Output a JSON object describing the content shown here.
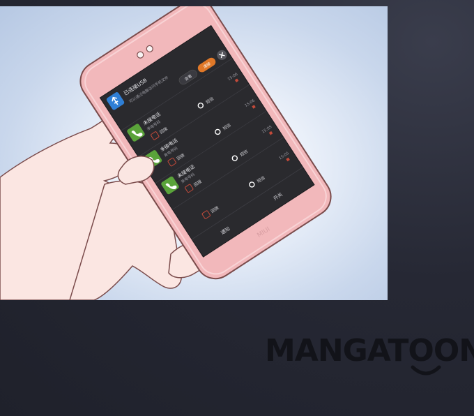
{
  "phone": {
    "status_title": "已连接USB",
    "status_subtitle": "可以通过电脑访问手机文件",
    "button_view": "查看",
    "button_close_all": "清除",
    "button_mark": "清除",
    "notifications": [
      {
        "title": "未接电话",
        "subtitle": "来电号码",
        "action_call": "回拨",
        "action_msg": "短信",
        "time": "15:06"
      },
      {
        "title": "未接电话",
        "subtitle": "来电号码",
        "action_call": "回拨",
        "action_msg": "短信",
        "time": "15:06"
      },
      {
        "title": "未接电话",
        "subtitle": "来电号码",
        "action_call": "回拨",
        "action_msg": "短信",
        "time": "15:05"
      },
      {
        "title": "",
        "subtitle": "",
        "action_call": "回拨",
        "action_msg": "短信",
        "time": "15:05"
      }
    ],
    "tab_left": "通知",
    "tab_right": "开关",
    "brand": "MIUI"
  },
  "watermark": {
    "text": "MANGATOON"
  },
  "colors": {
    "phone_body": "#f2b8bb",
    "screen": "#2a2a2e",
    "call_icon": "#5aa33a",
    "usb_icon": "#2f7fd6",
    "accent_orange": "#e07828",
    "background": "#232530"
  }
}
